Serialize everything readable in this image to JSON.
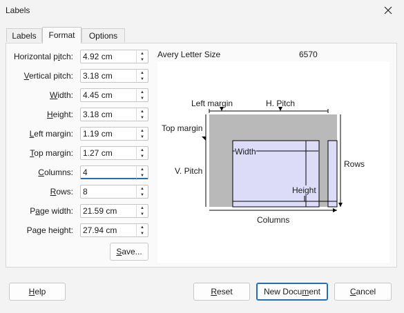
{
  "window": {
    "title": "Labels"
  },
  "tabs": [
    {
      "label": "Labels"
    },
    {
      "label": "Format"
    },
    {
      "label": "Options"
    }
  ],
  "form": {
    "fields": [
      {
        "label_pre": "Horizontal p",
        "label_ul": "i",
        "label_post": "tch:",
        "value": "4.92 cm"
      },
      {
        "label_pre": "",
        "label_ul": "V",
        "label_post": "ertical pitch:",
        "value": "3.18 cm"
      },
      {
        "label_pre": "",
        "label_ul": "W",
        "label_post": "idth:",
        "value": "4.45 cm"
      },
      {
        "label_pre": "",
        "label_ul": "H",
        "label_post": "eight:",
        "value": "3.18 cm"
      },
      {
        "label_pre": "",
        "label_ul": "L",
        "label_post": "eft margin:",
        "value": "1.19 cm"
      },
      {
        "label_pre": "",
        "label_ul": "T",
        "label_post": "op margin:",
        "value": "1.27 cm"
      },
      {
        "label_pre": "",
        "label_ul": "C",
        "label_post": "olumns:",
        "value": "4"
      },
      {
        "label_pre": "",
        "label_ul": "R",
        "label_post": "ows:",
        "value": "8"
      },
      {
        "label_pre": "P",
        "label_ul": "a",
        "label_post": "ge width:",
        "value": "21.59 cm"
      },
      {
        "label_pre": "Pa",
        "label_ul": "g",
        "label_post": "e height:",
        "value": "27.94 cm"
      }
    ],
    "save_button": {
      "ul": "S",
      "rest": "ave..."
    }
  },
  "preview": {
    "brand": "Avery Letter Size",
    "type": "6570",
    "captions": {
      "left_margin": "Left margin",
      "h_pitch": "H. Pitch",
      "top_margin": "Top margin",
      "width": "Width",
      "v_pitch": "V. Pitch",
      "rows": "Rows",
      "height": "Height",
      "columns": "Columns"
    },
    "colors": {
      "sheet": "#b9b9b9",
      "label": "#dcdcf8",
      "line": "#000000"
    }
  },
  "footer": {
    "help": {
      "ul": "H",
      "rest": "elp"
    },
    "reset": {
      "ul": "R",
      "rest": "eset"
    },
    "new_document": {
      "pre": "New Docu",
      "ul": "m",
      "rest": "ent"
    },
    "cancel": {
      "ul": "C",
      "rest": "ancel"
    }
  }
}
